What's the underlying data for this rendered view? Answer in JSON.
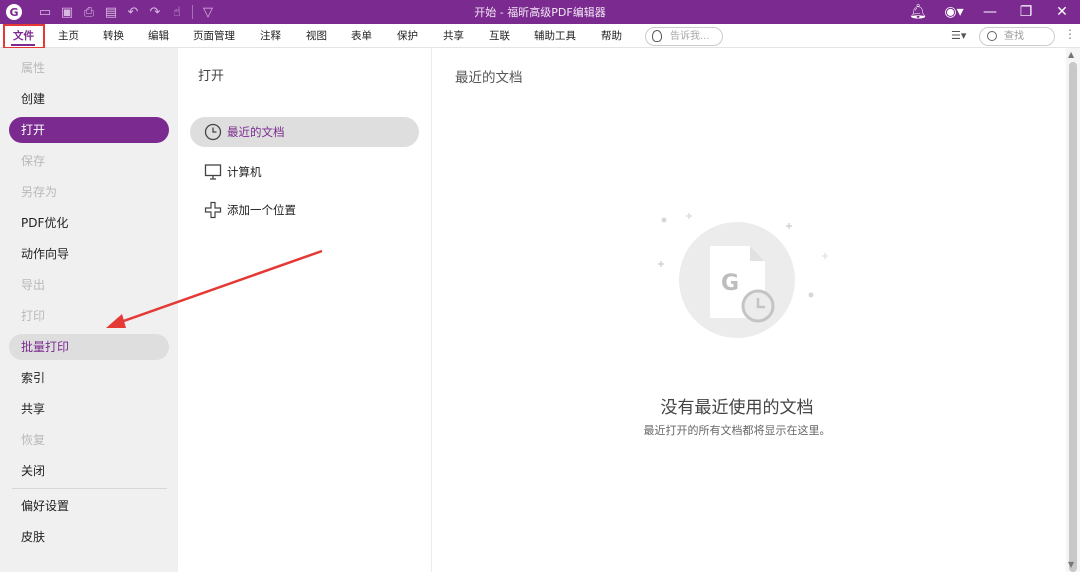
{
  "titlebar": {
    "title": "开始 - 福昕高级PDF编辑器",
    "logo_letter": "G"
  },
  "menu": {
    "items": [
      "文件",
      "主页",
      "转换",
      "编辑",
      "页面管理",
      "注释",
      "视图",
      "表单",
      "保护",
      "共享",
      "互联",
      "辅助工具",
      "帮助"
    ],
    "tell_me_placeholder": "告诉我...",
    "search_placeholder": "查找"
  },
  "sidebar": {
    "items": [
      {
        "label": "属性",
        "state": "disabled"
      },
      {
        "label": "创建",
        "state": "normal"
      },
      {
        "label": "打开",
        "state": "active"
      },
      {
        "label": "保存",
        "state": "disabled"
      },
      {
        "label": "另存为",
        "state": "disabled"
      },
      {
        "label": "PDF优化",
        "state": "normal"
      },
      {
        "label": "动作向导",
        "state": "normal"
      },
      {
        "label": "导出",
        "state": "disabled"
      },
      {
        "label": "打印",
        "state": "disabled"
      },
      {
        "label": "批量打印",
        "state": "hover"
      },
      {
        "label": "索引",
        "state": "normal"
      },
      {
        "label": "共享",
        "state": "normal"
      },
      {
        "label": "恢复",
        "state": "disabled"
      },
      {
        "label": "关闭",
        "state": "normal"
      },
      {
        "label": "偏好设置",
        "state": "normal"
      },
      {
        "label": "皮肤",
        "state": "normal"
      }
    ]
  },
  "open_panel": {
    "title": "打开",
    "options": [
      {
        "label": "最近的文档",
        "icon": "clock-icon",
        "selected": true
      },
      {
        "label": "计算机",
        "icon": "monitor-icon",
        "selected": false
      },
      {
        "label": "添加一个位置",
        "icon": "plus-icon",
        "selected": false
      }
    ]
  },
  "content": {
    "title": "最近的文档",
    "empty_title": "没有最近使用的文档",
    "empty_subtitle": "最近打开的所有文档都将显示在这里。"
  },
  "colors": {
    "brand": "#7b2b8f",
    "annotation_red": "#e53935"
  }
}
